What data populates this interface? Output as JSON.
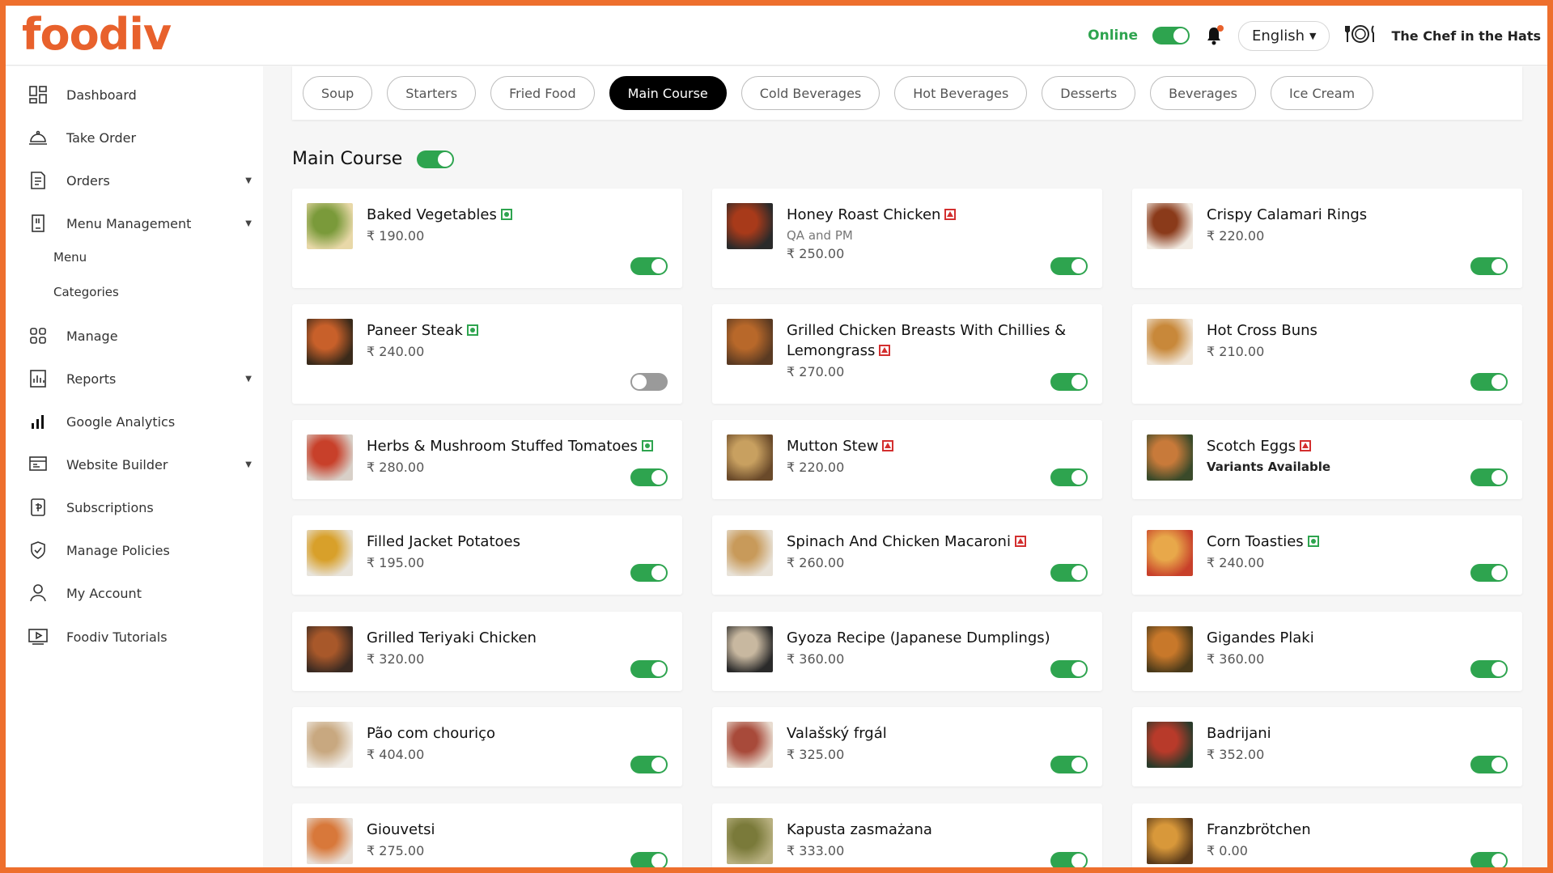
{
  "brand": {
    "logo": "foodiv"
  },
  "header": {
    "online_label": "Online",
    "online": true,
    "language": "English",
    "restaurant_name": "The Chef in the Hats"
  },
  "sidebar": {
    "items": [
      {
        "label": "Dashboard",
        "icon": "dashboard-icon",
        "has_arrow": false
      },
      {
        "label": "Take Order",
        "icon": "cloche-icon",
        "has_arrow": false
      },
      {
        "label": "Orders",
        "icon": "orders-icon",
        "has_arrow": true
      },
      {
        "label": "Menu Management",
        "icon": "menu-book-icon",
        "has_arrow": true
      },
      {
        "label": "Manage",
        "icon": "grid-icon",
        "has_arrow": false
      },
      {
        "label": "Reports",
        "icon": "reports-icon",
        "has_arrow": true
      },
      {
        "label": "Google Analytics",
        "icon": "analytics-icon",
        "has_arrow": false
      },
      {
        "label": "Website Builder",
        "icon": "website-icon",
        "has_arrow": true
      },
      {
        "label": "Subscriptions",
        "icon": "subscription-icon",
        "has_arrow": false
      },
      {
        "label": "Manage Policies",
        "icon": "shield-icon",
        "has_arrow": false
      },
      {
        "label": "My Account",
        "icon": "user-icon",
        "has_arrow": false
      },
      {
        "label": "Foodiv Tutorials",
        "icon": "video-icon",
        "has_arrow": false
      }
    ],
    "sub_items": [
      {
        "label": "Menu"
      },
      {
        "label": "Categories"
      }
    ]
  },
  "categories": [
    {
      "label": "Soup",
      "active": false
    },
    {
      "label": "Starters",
      "active": false
    },
    {
      "label": "Fried Food",
      "active": false
    },
    {
      "label": "Main Course",
      "active": true
    },
    {
      "label": "Cold Beverages",
      "active": false
    },
    {
      "label": "Hot Beverages",
      "active": false
    },
    {
      "label": "Desserts",
      "active": false
    },
    {
      "label": "Beverages",
      "active": false
    },
    {
      "label": "Ice Cream",
      "active": false
    }
  ],
  "section": {
    "title": "Main Course",
    "enabled": true
  },
  "colors": {
    "brand": "#e8612c",
    "toggle_on": "#2ea44f",
    "toggle_off": "#9a9a9a",
    "veg": "#2ea44f",
    "nonveg": "#d32f2f"
  },
  "items": [
    {
      "name": "Baked Vegetables",
      "diet": "veg",
      "sub": "",
      "variant": "",
      "price": "₹ 190.00",
      "available": true,
      "img": [
        "#e8d8a8",
        "#7a9a3a"
      ]
    },
    {
      "name": "Honey Roast Chicken",
      "diet": "nonveg",
      "sub": "QA and PM",
      "variant": "",
      "price": "₹ 250.00",
      "available": true,
      "img": [
        "#2a2a2a",
        "#a83a1a"
      ]
    },
    {
      "name": "Crispy Calamari Rings",
      "diet": "",
      "sub": "",
      "variant": "",
      "price": "₹ 220.00",
      "available": true,
      "img": [
        "#f2ece4",
        "#8a3a1a"
      ]
    },
    {
      "name": "Paneer Steak",
      "diet": "veg",
      "sub": "",
      "variant": "",
      "price": "₹ 240.00",
      "available": false,
      "img": [
        "#3a2a1a",
        "#c8602a"
      ]
    },
    {
      "name": "Grilled Chicken Breasts With Chillies & Lemongrass",
      "diet": "nonveg",
      "sub": "",
      "variant": "",
      "price": "₹ 270.00",
      "available": true,
      "img": [
        "#5a3a22",
        "#b8682a"
      ]
    },
    {
      "name": "Hot Cross Buns",
      "diet": "",
      "sub": "",
      "variant": "",
      "price": "₹ 210.00",
      "available": true,
      "img": [
        "#f0e6d8",
        "#c8883a"
      ]
    },
    {
      "name": "Herbs & Mushroom Stuffed Tomatoes",
      "diet": "veg",
      "sub": "",
      "variant": "",
      "price": "₹ 280.00",
      "available": true,
      "img": [
        "#d8d0c8",
        "#c8402a"
      ]
    },
    {
      "name": "Mutton Stew",
      "diet": "nonveg",
      "sub": "",
      "variant": "",
      "price": "₹ 220.00",
      "available": true,
      "img": [
        "#6a4a2a",
        "#c8a060"
      ]
    },
    {
      "name": "Scotch Eggs",
      "diet": "nonveg",
      "sub": "",
      "variant": "Variants Available",
      "price": "",
      "available": true,
      "img": [
        "#3a4a2a",
        "#c87a3a"
      ]
    },
    {
      "name": "Filled Jacket Potatoes",
      "diet": "",
      "sub": "",
      "variant": "",
      "price": "₹ 195.00",
      "available": true,
      "img": [
        "#e8e4dc",
        "#d8a02a"
      ]
    },
    {
      "name": "Spinach And Chicken Macaroni",
      "diet": "nonveg",
      "sub": "",
      "variant": "",
      "price": "₹ 260.00",
      "available": true,
      "img": [
        "#e8e2d8",
        "#c89a5a"
      ]
    },
    {
      "name": "Corn Toasties",
      "diet": "veg",
      "sub": "",
      "variant": "",
      "price": "₹ 240.00",
      "available": true,
      "img": [
        "#c8402a",
        "#e8a84a"
      ]
    },
    {
      "name": "Grilled Teriyaki Chicken",
      "diet": "",
      "sub": "",
      "variant": "",
      "price": "₹ 320.00",
      "available": true,
      "img": [
        "#3a2a22",
        "#a8582a"
      ]
    },
    {
      "name": "Gyoza Recipe (Japanese Dumplings)",
      "diet": "",
      "sub": "",
      "variant": "",
      "price": "₹ 360.00",
      "available": true,
      "img": [
        "#2a2a2a",
        "#c8b8a0"
      ]
    },
    {
      "name": "Gigandes Plaki",
      "diet": "",
      "sub": "",
      "variant": "",
      "price": "₹ 360.00",
      "available": true,
      "img": [
        "#4a3a1a",
        "#c8782a"
      ]
    },
    {
      "name": "Pão com chouriço",
      "diet": "",
      "sub": "",
      "variant": "",
      "price": "₹ 404.00",
      "available": true,
      "img": [
        "#f0ece6",
        "#c8a880"
      ]
    },
    {
      "name": "Valašský frgál",
      "diet": "",
      "sub": "",
      "variant": "",
      "price": "₹ 325.00",
      "available": true,
      "img": [
        "#e8dcd0",
        "#a84a3a"
      ]
    },
    {
      "name": "Badrijani",
      "diet": "",
      "sub": "",
      "variant": "",
      "price": "₹ 352.00",
      "available": true,
      "img": [
        "#2a3a2a",
        "#b83a2a"
      ]
    },
    {
      "name": "Giouvetsi",
      "diet": "",
      "sub": "",
      "variant": "",
      "price": "₹ 275.00",
      "available": true,
      "img": [
        "#e8e0d8",
        "#d8783a"
      ]
    },
    {
      "name": "Kapusta zasmażana",
      "diet": "",
      "sub": "",
      "variant": "",
      "price": "₹ 333.00",
      "available": true,
      "img": [
        "#b8b080",
        "#7a7a3a"
      ]
    },
    {
      "name": "Franzbrötchen",
      "diet": "",
      "sub": "",
      "variant": "",
      "price": "₹ 0.00",
      "available": true,
      "img": [
        "#5a3a1a",
        "#d8983a"
      ]
    }
  ]
}
